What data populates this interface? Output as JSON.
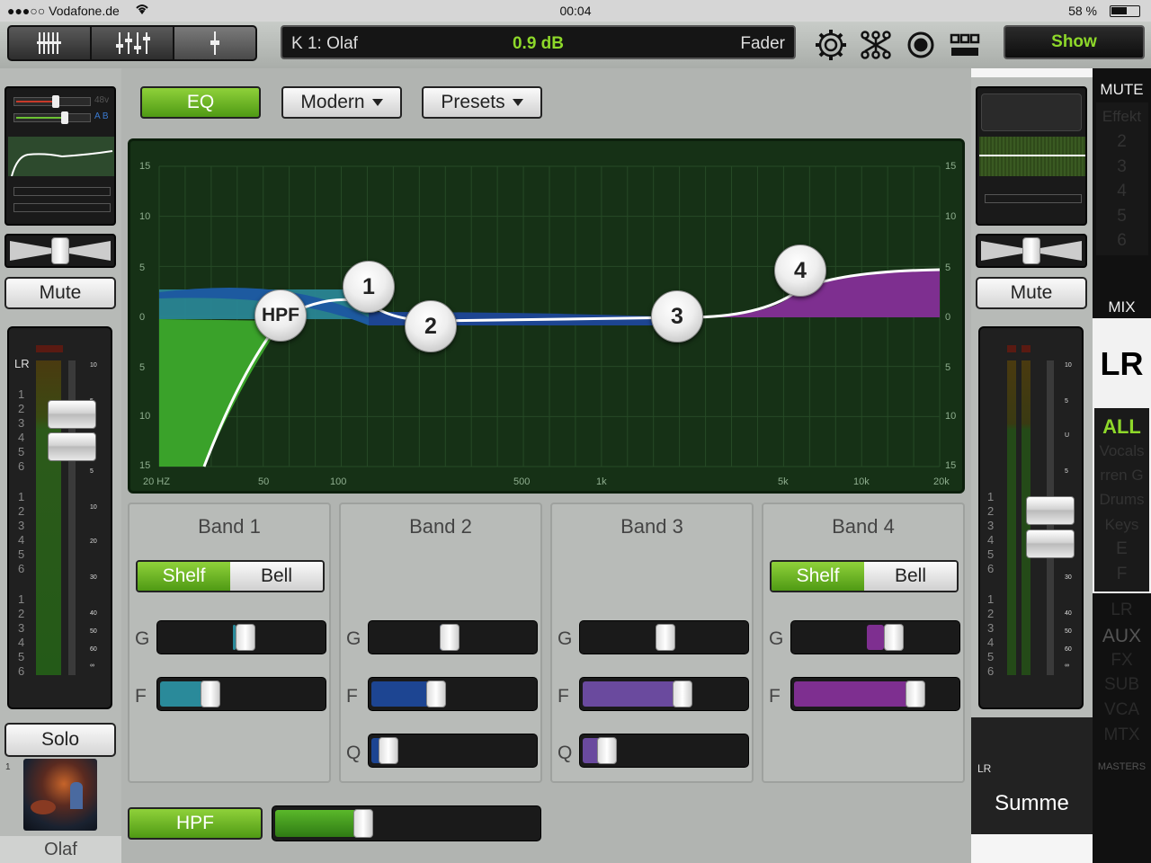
{
  "status_bar": {
    "carrier": "●●●○○ Vodafone.de",
    "time": "00:04",
    "battery_percent": "58 %",
    "battery_level": 0.58
  },
  "toolbar": {
    "display": {
      "channel": "K 1: Olaf",
      "value": "0.9 dB",
      "mode": "Fader"
    },
    "show_label": "Show",
    "icons": [
      "mixer-view-icon",
      "fader-bank-icon",
      "single-fader-icon",
      "gear-icon",
      "routing-icon",
      "record-icon",
      "layout-grid-icon"
    ]
  },
  "left_strip": {
    "phantom_label": "48v",
    "ab_label": "A B",
    "meter_label": "LR",
    "mute_label": "Mute",
    "solo_label": "Solo",
    "channel_number": "1",
    "channel_name": "Olaf",
    "fader_scale": [
      "10",
      "5",
      "U",
      "5",
      "10",
      "20",
      "30",
      "40",
      "50",
      "60",
      "∞"
    ],
    "bus_numbers": [
      "1",
      "2",
      "3",
      "4",
      "5",
      "6"
    ]
  },
  "eq": {
    "eq_label": "EQ",
    "mode_label": "Modern",
    "presets_label": "Presets",
    "y_labels": [
      "15",
      "10",
      "5",
      "0",
      "5",
      "10",
      "15"
    ],
    "x_labels": [
      "20 HZ",
      "50",
      "100",
      "500",
      "1k",
      "5k",
      "10k",
      "20k"
    ],
    "nodes": [
      "HPF",
      "1",
      "2",
      "3",
      "4"
    ]
  },
  "bands": [
    {
      "title": "Band 1",
      "shelf": "Shelf",
      "bell": "Bell",
      "has_type": true,
      "g": "G",
      "f": "F",
      "q": "",
      "gain": 0.52,
      "freq": 0.28,
      "color": "#2a8a9a"
    },
    {
      "title": "Band 2",
      "has_type": false,
      "g": "G",
      "f": "F",
      "q": "Q",
      "gain": 0.47,
      "freq": 0.38,
      "qv": 0.05,
      "color": "#1d4592"
    },
    {
      "title": "Band 3",
      "has_type": false,
      "g": "G",
      "f": "F",
      "q": "Q",
      "gain": 0.5,
      "freq": 0.62,
      "qv": 0.1,
      "color": "#6a4a9e"
    },
    {
      "title": "Band 4",
      "shelf": "Shelf",
      "bell": "Bell",
      "has_type": true,
      "g": "G",
      "f": "F",
      "q": "",
      "gain": 0.62,
      "freq": 0.77,
      "color": "#7e2f90"
    }
  ],
  "hpf": {
    "label": "HPF",
    "value": 0.32
  },
  "right_strip": {
    "mute_label": "Mute",
    "lr_tag": "LR",
    "name": "Summe"
  },
  "nav": {
    "mute_header": "MUTE",
    "mute_items": [
      "Effekt",
      "2",
      "3",
      "4",
      "5",
      "6"
    ],
    "mix_label": "MIX",
    "lr_label": "LR",
    "all_label": "ALL",
    "groups": [
      "Vocals",
      "rren  G",
      "Drums",
      "Keys",
      "E",
      "F"
    ],
    "lr_dim": "LR",
    "aux_label": "AUX",
    "dim_items": [
      "FX",
      "SUB",
      "VCA",
      "MTX"
    ],
    "masters_label": "MASTERS"
  }
}
